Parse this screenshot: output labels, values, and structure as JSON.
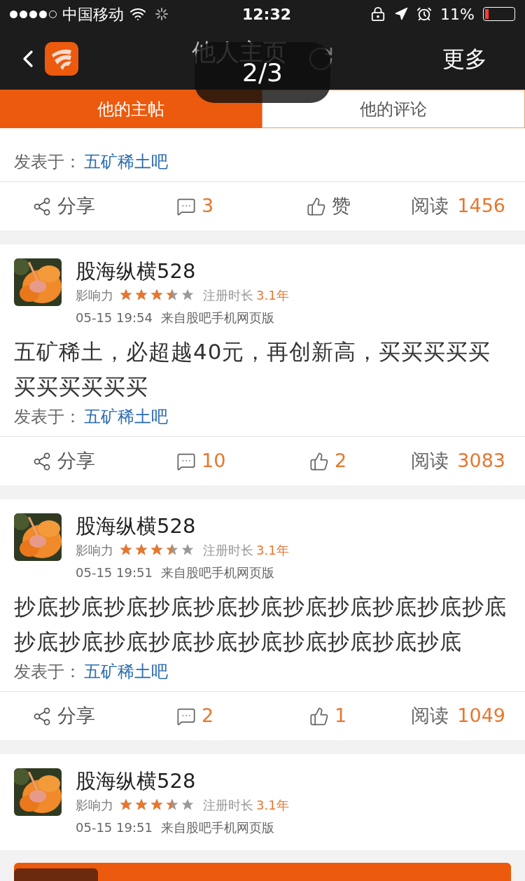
{
  "status_bar": {
    "carrier": "中国移动",
    "time": "12:32",
    "battery": "11%"
  },
  "nav": {
    "title": "他人主页",
    "more": "更多",
    "overlay": "2/3"
  },
  "tabs": [
    {
      "label": "他的主帖",
      "selected": true
    },
    {
      "label": "他的评论",
      "selected": false
    }
  ],
  "first_post_tail": {
    "posted_in_label": "发表于：",
    "forum": "五矿稀土吧",
    "share": "分享",
    "comments": "3",
    "like": "赞",
    "reads_label": "阅读",
    "reads": "1456"
  },
  "posts": [
    {
      "user": "股海纵横528",
      "influence_label": "影响力",
      "stars": 3.5,
      "reg_label": "注册时长",
      "reg": "3.1年",
      "time": "05-15 19:54",
      "source": "来自股吧手机网页版",
      "content": "五矿稀土，必超越40元，再创新高，买买买买买买买买买买买",
      "posted_in_label": "发表于：",
      "forum": "五矿稀土吧",
      "share": "分享",
      "comments": "10",
      "likes": "2",
      "reads_label": "阅读",
      "reads": "3083"
    },
    {
      "user": "股海纵横528",
      "influence_label": "影响力",
      "stars": 3.5,
      "reg_label": "注册时长",
      "reg": "3.1年",
      "time": "05-15 19:51",
      "source": "来自股吧手机网页版",
      "content": "抄底抄底抄底抄底抄底抄底抄底抄底抄底抄底抄底抄底抄底抄底抄底抄底抄底抄底抄底抄底抄底",
      "posted_in_label": "发表于：",
      "forum": "五矿稀土吧",
      "share": "分享",
      "comments": "2",
      "likes": "1",
      "reads_label": "阅读",
      "reads": "1049"
    },
    {
      "user": "股海纵横528",
      "influence_label": "影响力",
      "stars": 3.5,
      "reg_label": "注册时长",
      "reg": "3.1年",
      "time": "05-15 19:51",
      "source": "来自股吧手机网页版"
    }
  ]
}
